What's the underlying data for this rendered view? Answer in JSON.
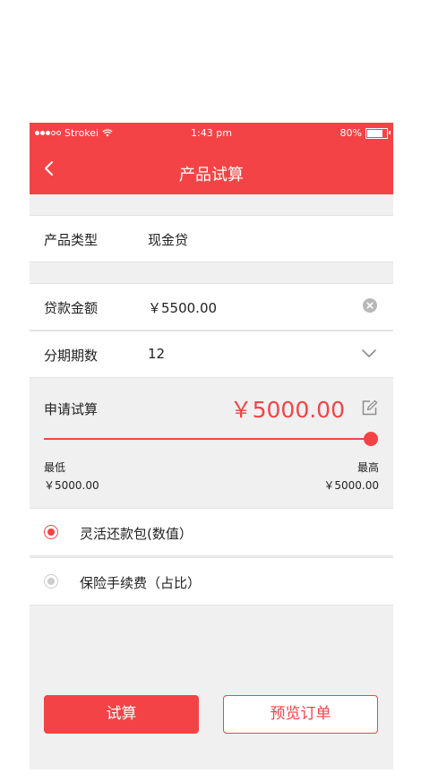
{
  "status_bar": {
    "carrier": "Strokei",
    "time": "1:43 pm",
    "battery": "80%",
    "battery_level": 0.8
  },
  "nav": {
    "title": "产品试算"
  },
  "product": {
    "label": "产品类型",
    "value": "现金贷"
  },
  "loan_amount": {
    "label": "贷款金额",
    "value": "￥5500.00"
  },
  "installments": {
    "label": "分期期数",
    "value": "12"
  },
  "calculation": {
    "label": "申请试算",
    "amount": "￥5000.00",
    "slider_level": 1.0,
    "min_label": "最低",
    "min_value": "￥5000.00",
    "max_label": "最高",
    "max_value": "￥5000.00"
  },
  "options": [
    {
      "label": "灵活还款包(数值）",
      "selected": true
    },
    {
      "label": "保险手续费（占比）",
      "selected": false
    }
  ],
  "buttons": {
    "calculate": "试算",
    "preview": "预览订单"
  },
  "colors": {
    "accent": "#f44346",
    "background": "#f0f0f0"
  }
}
